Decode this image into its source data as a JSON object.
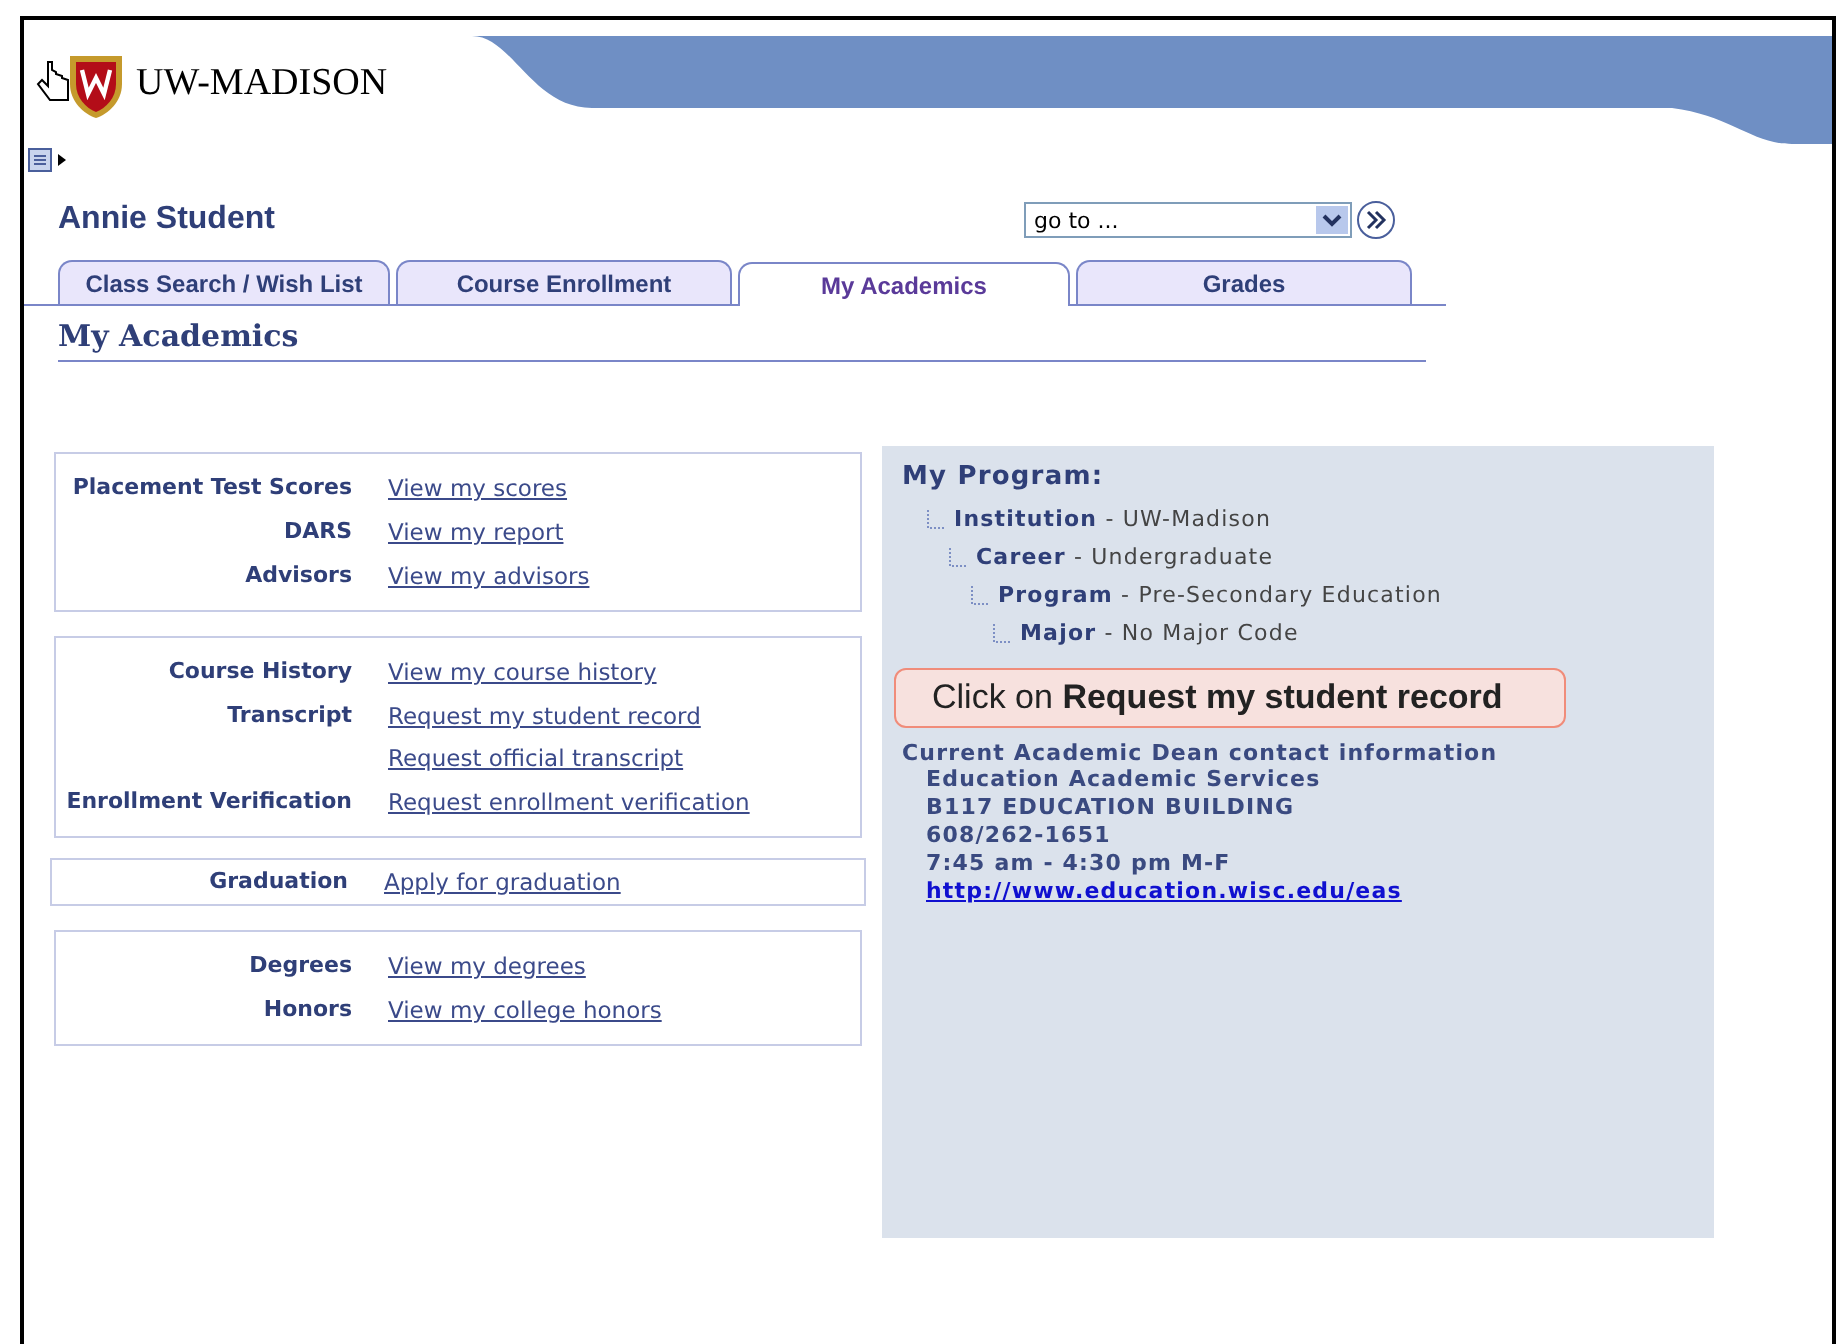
{
  "header": {
    "logo_text": "UW-MADISON"
  },
  "student_name": "Annie Student",
  "goto": {
    "value": "go to ..."
  },
  "tabs": [
    {
      "label": "Class Search / Wish List",
      "selected": false
    },
    {
      "label": "Course Enrollment",
      "selected": false
    },
    {
      "label": "My Academics",
      "selected": true
    },
    {
      "label": "Grades",
      "selected": false
    }
  ],
  "page_title": "My Academics",
  "groups": [
    {
      "rows": [
        {
          "label": "Placement Test Scores",
          "links": [
            "View my scores"
          ]
        },
        {
          "label": "DARS",
          "links": [
            "View my report"
          ]
        },
        {
          "label": "Advisors",
          "links": [
            "View my advisors"
          ]
        }
      ]
    },
    {
      "rows": [
        {
          "label": "Course History",
          "links": [
            "View my course history"
          ]
        },
        {
          "label": "Transcript",
          "links": [
            "Request my student record",
            "Request official transcript"
          ]
        },
        {
          "label": "Enrollment Verification",
          "links": [
            "Request enrollment verification"
          ]
        }
      ]
    },
    {
      "rows": [
        {
          "label": "Graduation",
          "links": [
            "Apply for graduation"
          ]
        }
      ]
    },
    {
      "rows": [
        {
          "label": "Degrees",
          "links": [
            "View my degrees"
          ]
        },
        {
          "label": "Honors",
          "links": [
            "View my college honors"
          ]
        }
      ]
    }
  ],
  "program": {
    "title": "My Program:",
    "tree": [
      {
        "text": "**Institution** - UW-Madison",
        "children": [
          {
            "text": "**Career** - Undergraduate",
            "children": [
              {
                "text": "**Program** - Pre-Secondary Education",
                "children": [
                  {
                    "text": "**Major** - No Major Code"
                  }
                ]
              }
            ]
          }
        ]
      }
    ],
    "contact_title": "Current Academic Dean contact information",
    "contact_lines": [
      "Education Academic Services",
      "B117 EDUCATION BUILDING",
      "608/262-1651",
      "7:45 am - 4:30 pm M-F"
    ],
    "contact_url": "http://www.education.wisc.edu/eas"
  },
  "callout": "Click on **Request my student record**"
}
